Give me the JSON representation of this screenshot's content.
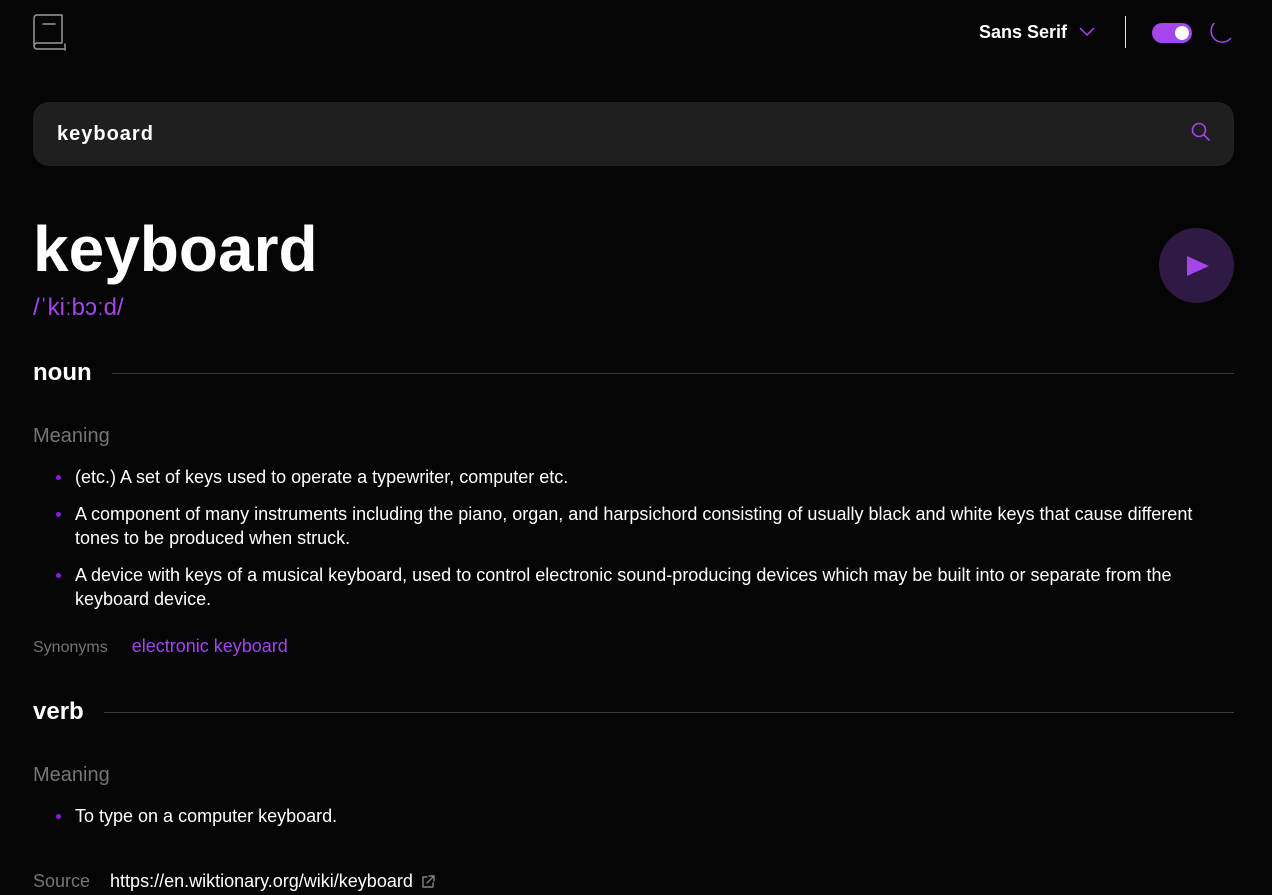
{
  "header": {
    "logo_icon": "book-icon",
    "font_select": {
      "selected": "Sans Serif",
      "icon": "chevron-down-icon"
    },
    "theme_toggle": {
      "on": true,
      "accent": "#a445ed"
    },
    "theme_icon": "moon-icon"
  },
  "search": {
    "value": "keyboard",
    "icon": "search-icon"
  },
  "entry": {
    "word": "keyboard",
    "phonetic": "/ˈkiːbɔːd/",
    "play_icon": "play-icon",
    "meanings": [
      {
        "part_of_speech": "noun",
        "label": "Meaning",
        "definitions": [
          "(etc.) A set of keys used to operate a typewriter, computer etc.",
          "A component of many instruments including the piano, organ, and harpsichord consisting of usually black and white keys that cause different tones to be produced when struck.",
          "A device with keys of a musical keyboard, used to control electronic sound-producing devices which may be built into or separate from the keyboard device."
        ],
        "synonyms_label": "Synonyms",
        "synonyms": "electronic keyboard"
      },
      {
        "part_of_speech": "verb",
        "label": "Meaning",
        "definitions": [
          "To type on a computer keyboard."
        ]
      }
    ]
  },
  "source": {
    "label": "Source",
    "url": "https://en.wiktionary.org/wiki/keyboard",
    "icon": "external-link-icon"
  },
  "colors": {
    "accent": "#a445ed",
    "background": "#050505",
    "search_bg": "#1f1f1f",
    "muted": "#757575"
  }
}
